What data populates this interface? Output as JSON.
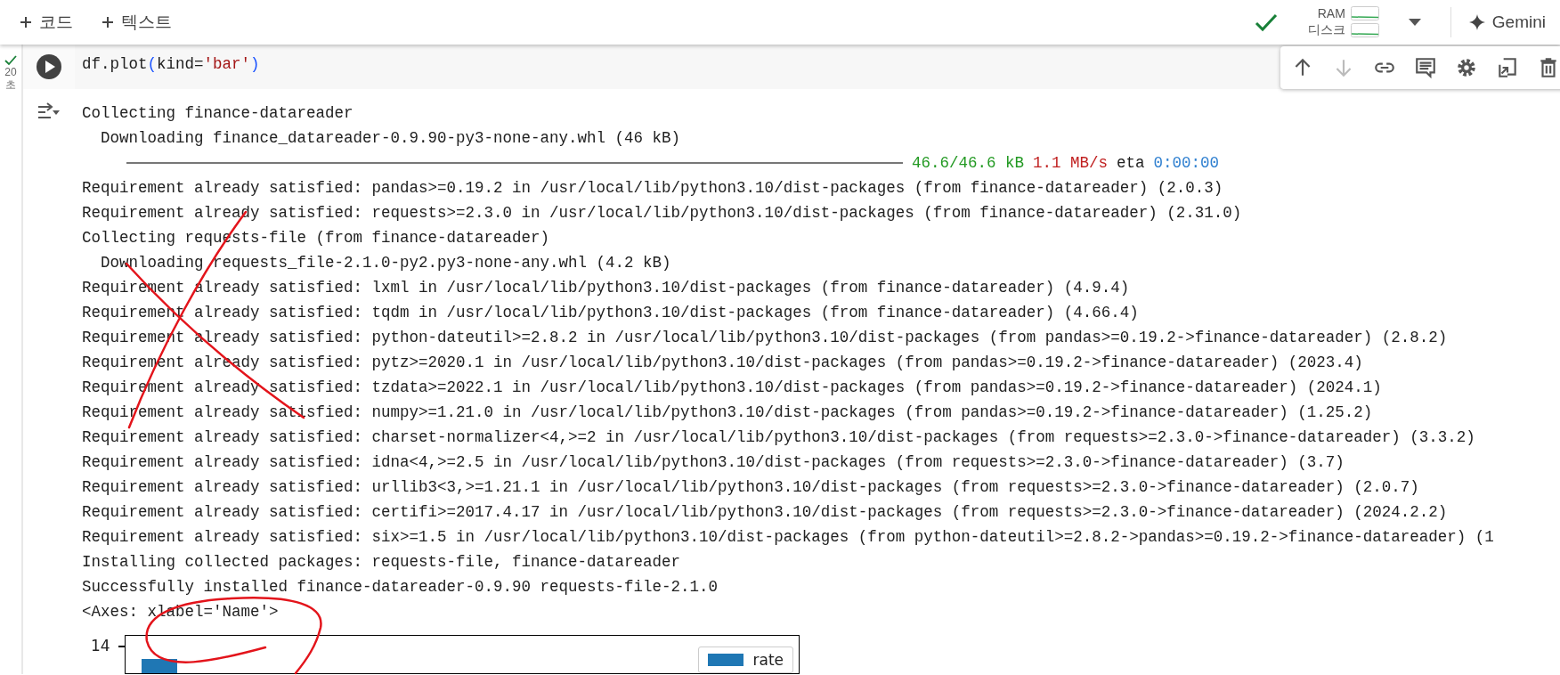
{
  "header": {
    "add_buttons": [
      {
        "label": "코드"
      },
      {
        "label": "텍스트"
      }
    ],
    "resources": [
      {
        "label": "RAM"
      },
      {
        "label": "디스크"
      }
    ],
    "gemini": {
      "label": "Gemini"
    }
  },
  "cell": {
    "time": "20",
    "time_unit": "초",
    "code": [
      {
        "kind": "plain",
        "text": "df.plot"
      },
      {
        "kind": "paren",
        "text": "("
      },
      {
        "kind": "plain",
        "text": "kind="
      },
      {
        "kind": "string",
        "text": "'bar'"
      },
      {
        "kind": "paren",
        "text": ")"
      }
    ],
    "toolbar": [
      {
        "kind": "up",
        "disabled": false
      },
      {
        "kind": "down",
        "disabled": true
      },
      {
        "kind": "link",
        "disabled": false
      },
      {
        "kind": "comment",
        "disabled": false
      },
      {
        "kind": "settings",
        "disabled": false
      },
      {
        "kind": "mirror",
        "disabled": false
      },
      {
        "kind": "delete",
        "disabled": false
      }
    ]
  },
  "output": [
    {
      "kind": "text",
      "text": "Collecting finance-datareader"
    },
    {
      "kind": "text",
      "text": "  Downloading finance_datareader-0.9.90-py3-none-any.whl (46 kB)"
    },
    {
      "kind": "progress",
      "level": 1,
      "size": "46.6/46.6 kB",
      "speed": "1.1 MB/s",
      "eta_label": "eta",
      "eta": "0:00:00"
    },
    {
      "kind": "text",
      "text": "Requirement already satisfied: pandas>=0.19.2 in /usr/local/lib/python3.10/dist-packages (from finance-datareader) (2.0.3)"
    },
    {
      "kind": "text",
      "text": "Requirement already satisfied: requests>=2.3.0 in /usr/local/lib/python3.10/dist-packages (from finance-datareader) (2.31.0)"
    },
    {
      "kind": "text",
      "text": "Collecting requests-file (from finance-datareader)"
    },
    {
      "kind": "text",
      "text": "  Downloading requests_file-2.1.0-py2.py3-none-any.whl (4.2 kB)"
    },
    {
      "kind": "text",
      "text": "Requirement already satisfied: lxml in /usr/local/lib/python3.10/dist-packages (from finance-datareader) (4.9.4)"
    },
    {
      "kind": "text",
      "text": "Requirement already satisfied: tqdm in /usr/local/lib/python3.10/dist-packages (from finance-datareader) (4.66.4)"
    },
    {
      "kind": "text",
      "text": "Requirement already satisfied: python-dateutil>=2.8.2 in /usr/local/lib/python3.10/dist-packages (from pandas>=0.19.2->finance-datareader) (2.8.2)"
    },
    {
      "kind": "text",
      "text": "Requirement already satisfied: pytz>=2020.1 in /usr/local/lib/python3.10/dist-packages (from pandas>=0.19.2->finance-datareader) (2023.4)"
    },
    {
      "kind": "text",
      "text": "Requirement already satisfied: tzdata>=2022.1 in /usr/local/lib/python3.10/dist-packages (from pandas>=0.19.2->finance-datareader) (2024.1)"
    },
    {
      "kind": "text",
      "text": "Requirement already satisfied: numpy>=1.21.0 in /usr/local/lib/python3.10/dist-packages (from pandas>=0.19.2->finance-datareader) (1.25.2)"
    },
    {
      "kind": "text",
      "text": "Requirement already satisfied: charset-normalizer<4,>=2 in /usr/local/lib/python3.10/dist-packages (from requests>=2.3.0->finance-datareader) (3.3.2)"
    },
    {
      "kind": "text",
      "text": "Requirement already satisfied: idna<4,>=2.5 in /usr/local/lib/python3.10/dist-packages (from requests>=2.3.0->finance-datareader) (3.7)"
    },
    {
      "kind": "text",
      "text": "Requirement already satisfied: urllib3<3,>=1.21.1 in /usr/local/lib/python3.10/dist-packages (from requests>=2.3.0->finance-datareader) (2.0.7)"
    },
    {
      "kind": "text",
      "text": "Requirement already satisfied: certifi>=2017.4.17 in /usr/local/lib/python3.10/dist-packages (from requests>=2.3.0->finance-datareader) (2024.2.2)"
    },
    {
      "kind": "text",
      "text": "Requirement already satisfied: six>=1.5 in /usr/local/lib/python3.10/dist-packages (from python-dateutil>=2.8.2->pandas>=0.19.2->finance-datareader) (1"
    },
    {
      "kind": "text",
      "text": "Installing collected packages: requests-file, finance-datareader"
    },
    {
      "kind": "text",
      "text": "Successfully installed finance-datareader-0.9.90 requests-file-2.1.0"
    },
    {
      "kind": "text",
      "text": "<Axes: xlabel='Name'>"
    }
  ],
  "plot": {
    "ytick": "14",
    "legend": "rate"
  }
}
